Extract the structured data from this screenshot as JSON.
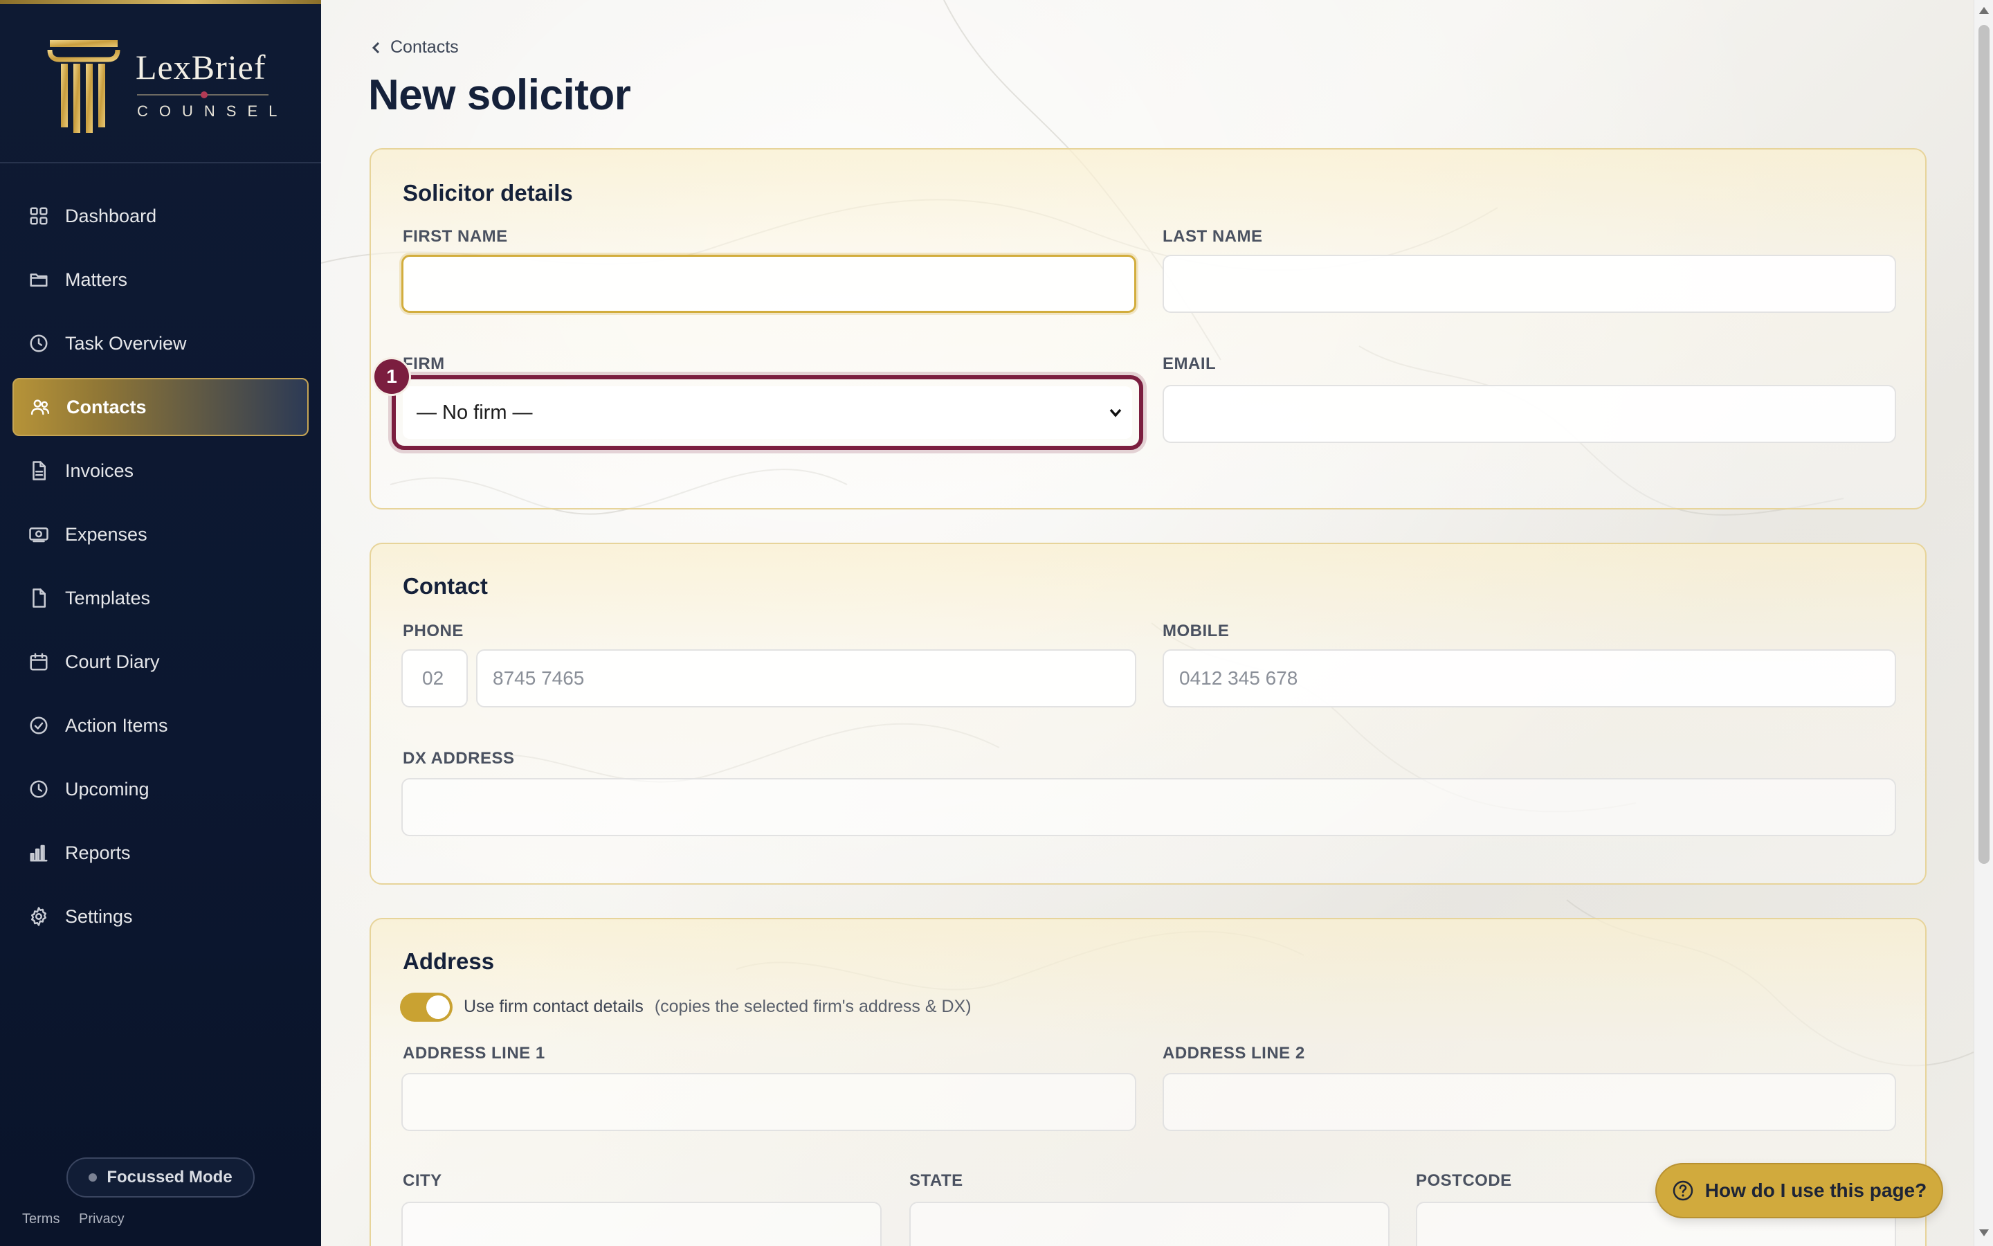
{
  "brand": {
    "name": "LexBrief",
    "sub": "COUNSEL"
  },
  "sidebar": {
    "items": [
      {
        "label": "Dashboard",
        "icon": "grid-icon"
      },
      {
        "label": "Matters",
        "icon": "folder-icon"
      },
      {
        "label": "Task Overview",
        "icon": "clock-icon"
      },
      {
        "label": "Contacts",
        "icon": "users-icon",
        "active": true
      },
      {
        "label": "Invoices",
        "icon": "file-text-icon"
      },
      {
        "label": "Expenses",
        "icon": "banknote-icon"
      },
      {
        "label": "Templates",
        "icon": "file-icon"
      },
      {
        "label": "Court Diary",
        "icon": "calendar-icon"
      },
      {
        "label": "Action Items",
        "icon": "check-circle-icon"
      },
      {
        "label": "Upcoming",
        "icon": "clock-icon"
      },
      {
        "label": "Reports",
        "icon": "bar-chart-icon"
      },
      {
        "label": "Settings",
        "icon": "gear-icon"
      }
    ],
    "focus_mode": "Focussed Mode",
    "footer": {
      "terms": "Terms",
      "privacy": "Privacy"
    }
  },
  "breadcrumb": {
    "label": "Contacts"
  },
  "page": {
    "title": "New solicitor"
  },
  "solicitor": {
    "title": "Solicitor details",
    "first_name_label": "FIRST NAME",
    "first_name_value": "",
    "last_name_label": "LAST NAME",
    "last_name_value": "",
    "firm_label": "FIRM",
    "firm_selected": "— No firm —",
    "firm_badge": "1",
    "email_label": "EMAIL",
    "email_value": ""
  },
  "contact": {
    "title": "Contact",
    "phone_label": "PHONE",
    "phone_area_placeholder": "02",
    "phone_placeholder": "8745 7465",
    "mobile_label": "MOBILE",
    "mobile_placeholder": "0412 345 678",
    "dx_label": "DX ADDRESS",
    "dx_value": ""
  },
  "address": {
    "title": "Address",
    "toggle_on": true,
    "toggle_label": "Use firm contact details",
    "toggle_hint": "(copies the selected firm's address & DX)",
    "line1_label": "ADDRESS LINE 1",
    "line2_label": "ADDRESS LINE 2",
    "city_label": "CITY",
    "state_label": "STATE",
    "postcode_label": "POSTCODE"
  },
  "help": {
    "label": "How do I use this page?"
  },
  "colors": {
    "accent_gold": "#d1aa3d",
    "sidebar_navy": "#0e1a33",
    "highlight_maroon": "#7b1e3f"
  }
}
